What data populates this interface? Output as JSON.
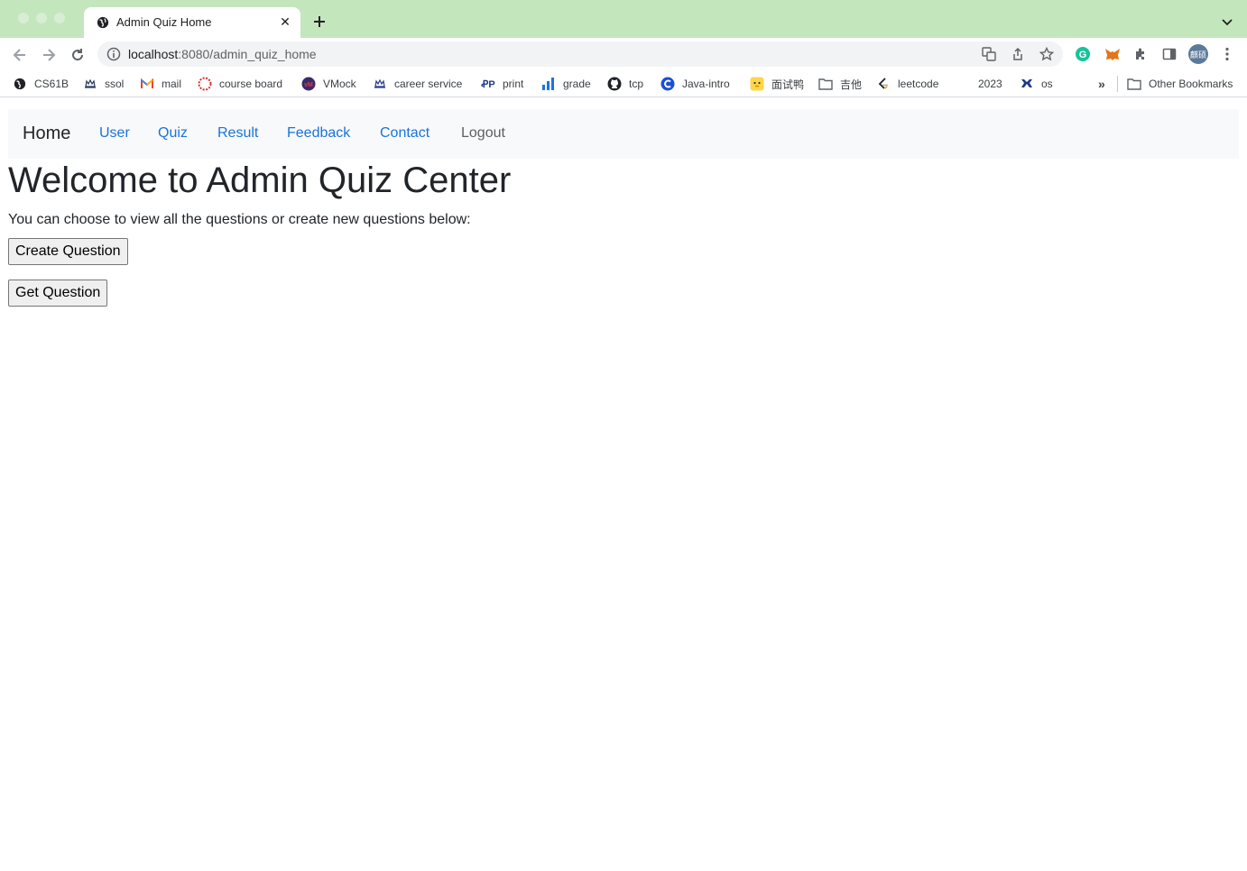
{
  "browser": {
    "tab_title": "Admin Quiz Home",
    "url_host": "localhost",
    "url_path": ":8080/admin_quiz_home",
    "profile_initials": "麒硕",
    "bookmarks": [
      {
        "label": "CS61B",
        "icon": "globe-icon"
      },
      {
        "label": "ssol",
        "icon": "crown-icon"
      },
      {
        "label": "mail",
        "icon": "gmail-icon"
      },
      {
        "label": "course board",
        "icon": "ring-icon"
      },
      {
        "label": "VMock",
        "icon": "vmock-icon"
      },
      {
        "label": "career service",
        "icon": "crown-icon"
      },
      {
        "label": "print",
        "icon": "papercut-icon"
      },
      {
        "label": "grade",
        "icon": "bar-chart-icon"
      },
      {
        "label": "tcp",
        "icon": "github-icon"
      },
      {
        "label": "Java-intro",
        "icon": "c-logo-icon"
      },
      {
        "label": "面试鸭",
        "icon": "duck-icon"
      },
      {
        "label": "吉他",
        "icon": "folder-icon"
      },
      {
        "label": "leetcode",
        "icon": "leetcode-icon"
      },
      {
        "label": "2023",
        "icon": "none"
      },
      {
        "label": "os",
        "icon": "columbia-icon"
      }
    ],
    "overflow_label": "»",
    "other_bookmarks": "Other Bookmarks"
  },
  "navbar": {
    "home": "Home",
    "links": [
      "User",
      "Quiz",
      "Result",
      "Feedback",
      "Contact"
    ],
    "logout": "Logout"
  },
  "main": {
    "title": "Welcome to Admin Quiz Center",
    "intro": "You can choose to view all the questions or create new questions below:",
    "create_button": "Create Question",
    "get_button": "Get Question"
  },
  "colors": {
    "tabstrip": "#c4e6bd",
    "nav_link": "#1a73d8",
    "navbar_bg": "#f8f9fa"
  }
}
